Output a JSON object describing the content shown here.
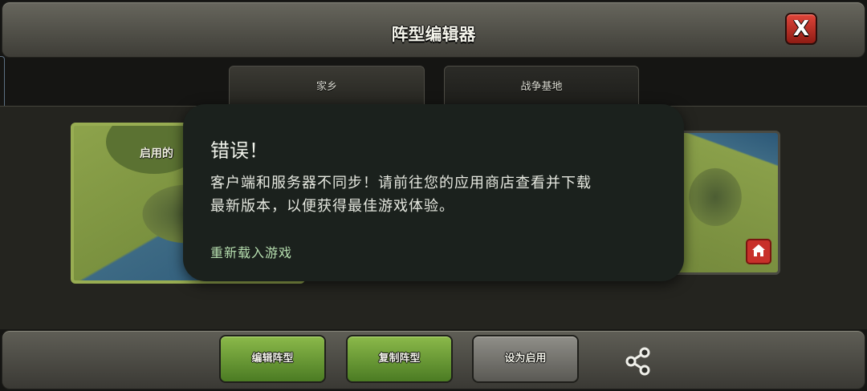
{
  "header": {
    "title": "阵型编辑器",
    "close_glyph": "X"
  },
  "tabs": [
    {
      "label": "家乡"
    },
    {
      "label": "战争基地"
    }
  ],
  "map": {
    "active_label": "启用的"
  },
  "dialog": {
    "title": "错误！",
    "message_line1": "客户端和服务器不同步！请前往您的应用商店查看并下载",
    "message_line2": "最新版本，以便获得最佳游戏体验。",
    "button": "重新载入游戏"
  },
  "footer": {
    "edit_label": "编辑阵型",
    "copy_label": "复制阵型",
    "set_active_label": "设为启用"
  },
  "icons": {
    "close": "close-icon",
    "home": "home-icon",
    "share": "share-icon"
  },
  "colors": {
    "accent_green": "#8bb94a",
    "close_red": "#e0453a",
    "dialog_bg": "#1b211d",
    "dialog_button": "#b7dfb0"
  }
}
